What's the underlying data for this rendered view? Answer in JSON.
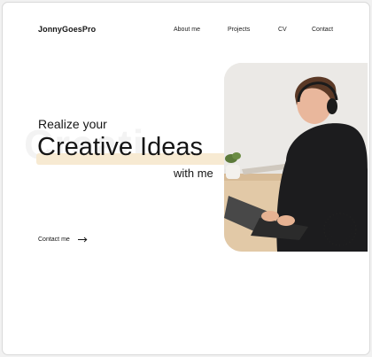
{
  "header": {
    "logo": "JonnyGoesPro",
    "nav": [
      {
        "label": "About me"
      },
      {
        "label": "Projects"
      },
      {
        "label": "CV"
      },
      {
        "label": "Contact"
      }
    ]
  },
  "hero": {
    "line1": "Realize your",
    "line2": "Creative Ideas",
    "line3": "with me",
    "watermark": "Creati",
    "cta": "Contact me"
  },
  "colors": {
    "text": "#151515",
    "highlight": "#f7ead2",
    "sweater": "#1c1c1e",
    "background": "#ffffff"
  },
  "icons": [
    "arrow-right-icon"
  ]
}
